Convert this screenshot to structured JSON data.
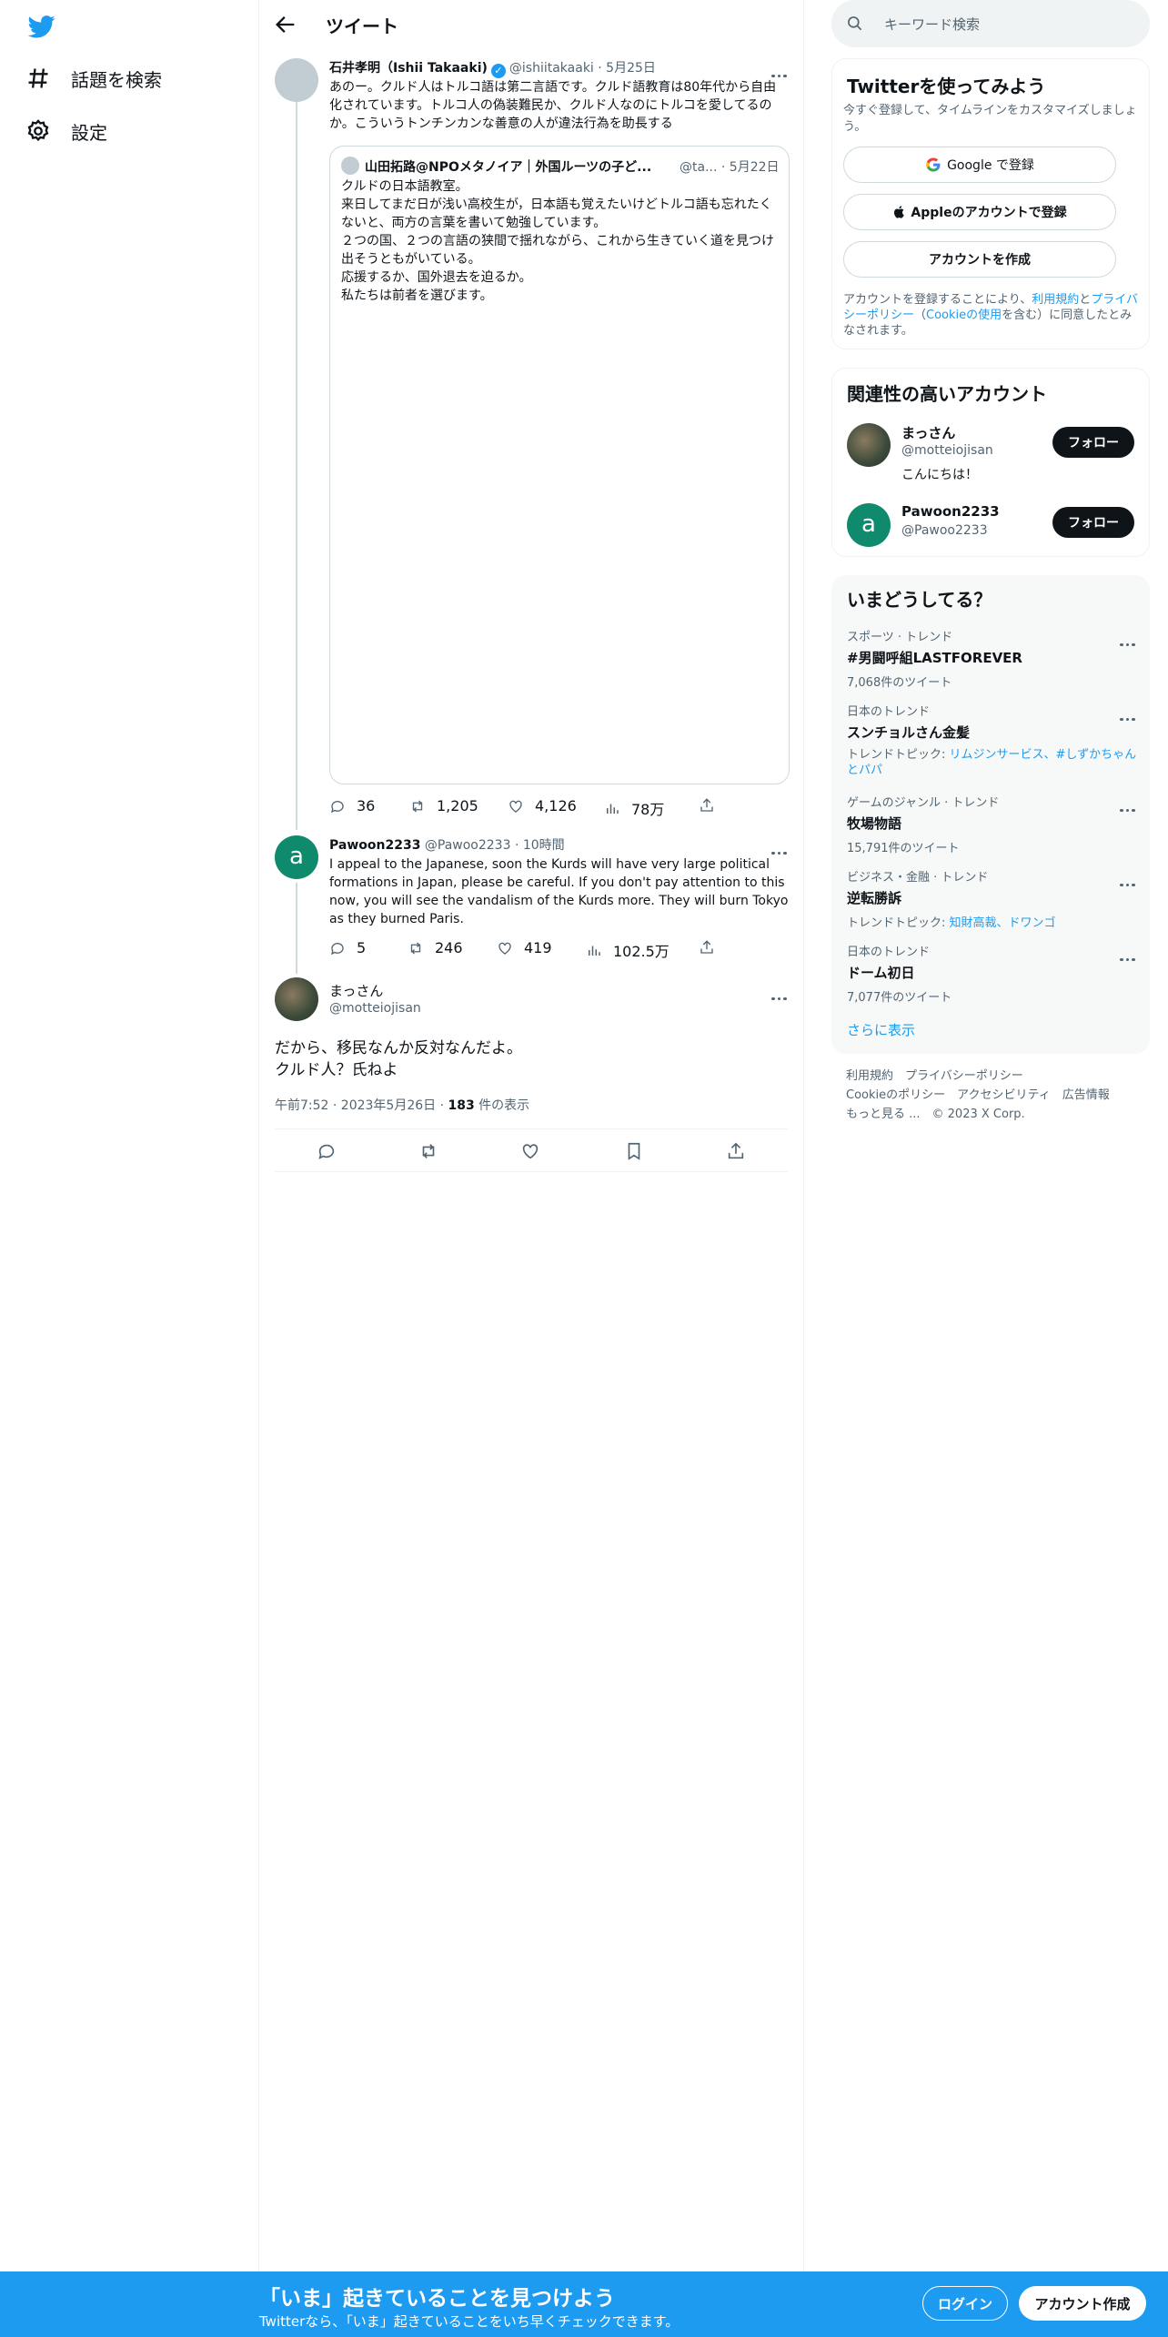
{
  "nav": {
    "items": [
      {
        "label": "話題を検索",
        "icon": "hashtag-icon"
      },
      {
        "label": "設定",
        "icon": "gear-icon"
      }
    ]
  },
  "header": {
    "title": "ツイート"
  },
  "tweet1": {
    "name": "石井孝明（Ishii Takaaki)",
    "handle": "@ishiitakaaki",
    "date": "5月25日",
    "text": "あのー。クルド人はトルコ語は第二言語です。クルド語教育は80年代から自由化されています。トルコ人の偽装難民か、クルド人なのにトルコを愛してるのか。こういうトンチンカンな善意の人が違法行為を助長する",
    "quote": {
      "name": "山田拓路@NPOメタノイア｜外国ルーツの子ど...",
      "handle": "@ta...",
      "date": "5月22日",
      "lines": [
        "クルドの日本語教室。",
        "来日してまだ日が浅い高校生が，日本語も覚えたいけどトルコ語も忘れたくないと、両方の言葉を書いて勉強しています。",
        "２つの国、２つの言語の狭間で揺れながら、これから生きていく道を見つけ出そうともがいている。",
        "応援するか、国外退去を迫るか。",
        "私たちは前者を選びます。"
      ]
    },
    "replies": "36",
    "retweets": "1,205",
    "likes": "4,126",
    "views": "78万"
  },
  "tweet2": {
    "avatar_letter": "a",
    "name": "Pawoon2233",
    "handle": "@Pawoo2233",
    "date": "10時間",
    "text": "I appeal to the Japanese, soon the Kurds will have very large political formations in Japan, please be careful. If you don't pay attention to this now, you will see the vandalism of the Kurds more. They will burn Tokyo as they burned Paris.",
    "replies": "5",
    "retweets": "246",
    "likes": "419",
    "views": "102.5万"
  },
  "main_tweet": {
    "name": "まっさん",
    "handle": "@motteiojisan",
    "line1": "だから、移民なんか反対なんだよ。",
    "line2": "クルド人？氏ねよ",
    "meta": "午前7:52 · 2023年5月26日 · ",
    "views_count": "183",
    "views_label": " 件の表示"
  },
  "search": {
    "placeholder": "キーワード検索"
  },
  "signup_card": {
    "title": "Twitterを使ってみよう",
    "subtitle": "今すぐ登録して、タイムラインをカスタマイズしましょう。",
    "google": "Google で登録",
    "apple": "Appleのアカウントで登録",
    "create": "アカウントを作成",
    "legal_pre": "アカウントを登録することにより、",
    "legal_terms": "利用規約",
    "legal_and": "と",
    "legal_privacy": "プライバシーポリシー",
    "legal_open": "（",
    "legal_cookie": "Cookieの使用",
    "legal_post": "を含む）に同意したとみなされます。"
  },
  "related": {
    "title": "関連性の高いアカウント",
    "accounts": [
      {
        "name": "まっさん",
        "handle": "@motteiojisan",
        "bio": "こんにちは！",
        "follow": "フォロー"
      },
      {
        "name": "Pawoon2233",
        "handle": "@Pawoo2233",
        "avatar_letter": "a",
        "follow": "フォロー"
      }
    ]
  },
  "trends": {
    "title": "いまどうしてる？",
    "items": [
      {
        "category": "スポーツ · トレンド",
        "title": "#男闘呼組LASTFOREVER",
        "sub": "7,068件のツイート"
      },
      {
        "category": "日本のトレンド",
        "title": "スンチョルさん金髪",
        "sub_pre": "トレンドトピック: ",
        "sub_links": "リムジンサービス、#しずかちゃんとパパ"
      },
      {
        "category": "ゲームのジャンル · トレンド",
        "title": "牧場物語",
        "sub": "15,791件のツイート"
      },
      {
        "category": "ビジネス・金融 · トレンド",
        "title": "逆転勝訴",
        "sub_pre": "トレンドトピック: ",
        "sub_links": "知財高裁、ドワンゴ"
      },
      {
        "category": "日本のトレンド",
        "title": "ドーム初日",
        "sub": "7,077件のツイート"
      }
    ],
    "show_more": "さらに表示"
  },
  "footer": {
    "line1": "利用規約　プライバシーポリシー",
    "line2": "Cookieのポリシー　アクセシビリティ　広告情報",
    "line3": "もっと見る ...　© 2023 X Corp."
  },
  "banner": {
    "title": "「いま」起きていることを見つけよう",
    "subtitle": "Twitterなら、「いま」起きていることをいち早くチェックできます。",
    "login": "ログイン",
    "signup": "アカウント作成"
  }
}
